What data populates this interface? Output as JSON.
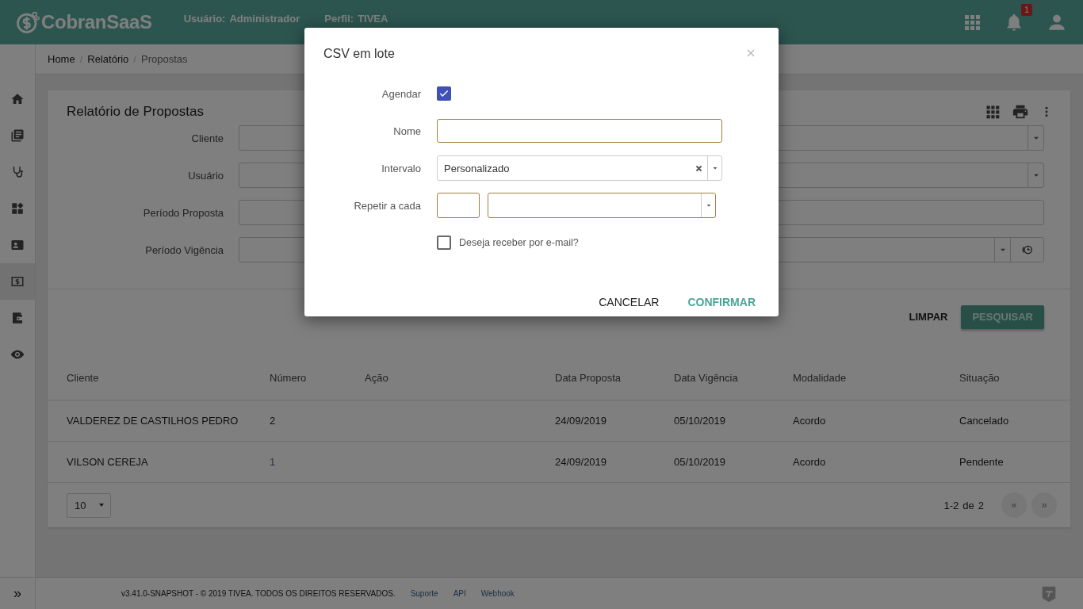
{
  "header": {
    "brand": "CobranSaaS",
    "user_label": "Usuário:",
    "user_value": "Administrador",
    "profile_label": "Perfil:",
    "profile_value": "TIVEA",
    "notification_count": "1"
  },
  "sidebar": {
    "items": [
      {
        "selected": false
      },
      {
        "selected": false
      },
      {
        "selected": false
      },
      {
        "selected": false
      },
      {
        "selected": false
      },
      {
        "selected": true
      },
      {
        "selected": false
      },
      {
        "selected": false
      }
    ]
  },
  "breadcrumb": [
    "Home",
    "Relatório",
    "Propostas"
  ],
  "breadcrumb_separator": "/",
  "report": {
    "title": "Relatório de Propostas",
    "filters": [
      {
        "kind": "select",
        "label": "Cliente"
      },
      {
        "kind": "select",
        "label": "Usuário"
      },
      {
        "kind": "text",
        "label": "Período Proposta"
      },
      {
        "kind": "period",
        "label": "Período Vigência"
      }
    ],
    "clear_button": "LIMPAR",
    "search_button": "PESQUISAR",
    "table": {
      "columns": [
        "Cliente",
        "Número",
        "Ação",
        "Data Proposta",
        "Data Vigência",
        "Modalidade",
        "Situação"
      ],
      "rows": [
        {
          "linked": false,
          "cells": [
            "VALDEREZ DE CASTILHOS PEDRO",
            "2",
            "",
            "24/09/2019",
            "05/10/2019",
            "Acordo",
            "Cancelado"
          ]
        },
        {
          "linked": true,
          "cells": [
            "VILSON CEREJA",
            "1",
            "",
            "24/09/2019",
            "05/10/2019",
            "Acordo",
            "Pendente"
          ]
        }
      ]
    },
    "page_size": "10",
    "range": "1-2",
    "range_of": "de",
    "range_total": "2",
    "prev": "«",
    "next": "»"
  },
  "footer": {
    "copyright": "v3.41.0-SNAPSHOT - © 2019 TIVEA. TODOS OS DIREITOS RESERVADOS.",
    "links": [
      "Suporte",
      "API",
      "Webhook"
    ],
    "expand": "»"
  },
  "modal": {
    "title": "CSV em lote",
    "fields": [
      {
        "kind": "checkbox",
        "label": "Agendar",
        "checked": true
      },
      {
        "kind": "text",
        "label": "Nome"
      },
      {
        "kind": "select",
        "label": "Intervalo",
        "value": "Personalizado"
      },
      {
        "kind": "repeat",
        "label": "Repetir a cada"
      },
      {
        "kind": "inline-checkbox",
        "label": "Deseja receber por e-mail?",
        "checked": false
      }
    ],
    "cancel": "CANCELAR",
    "confirm": "CONFIRMAR"
  }
}
